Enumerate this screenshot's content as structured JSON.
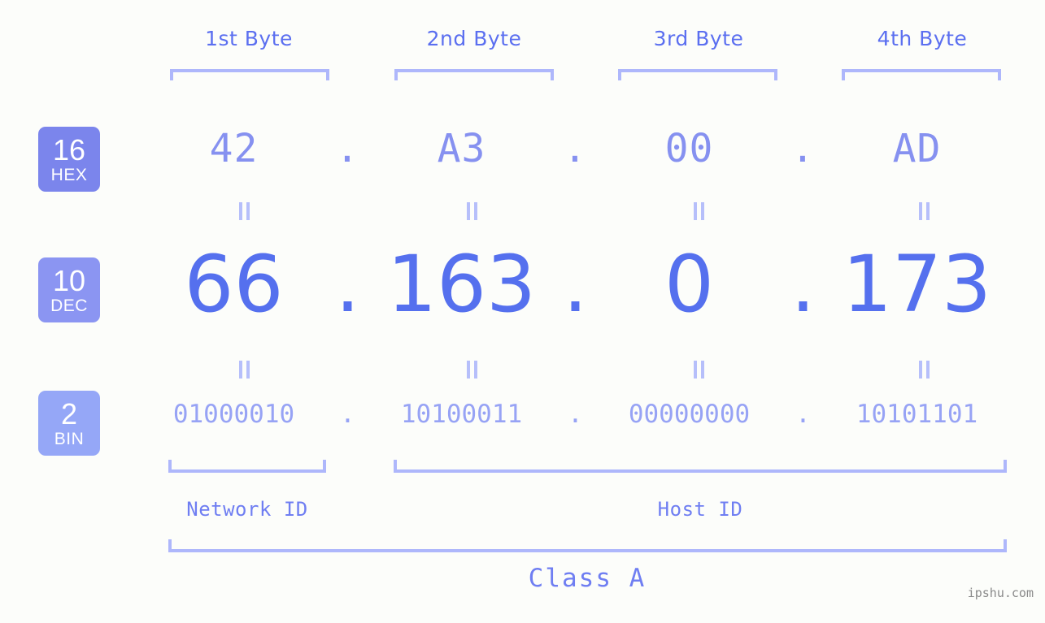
{
  "background_color": "#fcfdfa",
  "accent_colors": {
    "header_text": "#5b6ff0",
    "bracket": "#aeb7fb",
    "hex_text": "#8691f0",
    "dec_text": "#5570ee",
    "bin_text": "#97a3f5",
    "badge_hex": "#7b85ec",
    "badge_dec": "#8b95f2",
    "badge_bin": "#95a7f7",
    "label_text": "#6f7ef2",
    "watermark_text": "#8a8a8a"
  },
  "byte_headers": [
    {
      "label": "1st Byte"
    },
    {
      "label": "2nd Byte"
    },
    {
      "label": "3rd Byte"
    },
    {
      "label": "4th Byte"
    }
  ],
  "bases": [
    {
      "number": "16",
      "abbr": "HEX"
    },
    {
      "number": "10",
      "abbr": "DEC"
    },
    {
      "number": "2",
      "abbr": "BIN"
    }
  ],
  "separator": ".",
  "rows": {
    "hex": {
      "base_number": "16",
      "base_abbr": "HEX",
      "values": [
        "42",
        "A3",
        "00",
        "AD"
      ]
    },
    "dec": {
      "base_number": "10",
      "base_abbr": "DEC",
      "values": [
        "66",
        "163",
        "0",
        "173"
      ]
    },
    "bin": {
      "base_number": "2",
      "base_abbr": "BIN",
      "values": [
        "01000010",
        "10100011",
        "00000000",
        "10101101"
      ]
    }
  },
  "id_sections": [
    {
      "label": "Network ID"
    },
    {
      "label": "Host ID"
    }
  ],
  "class_label": "Class A",
  "watermark": "ipshu.com",
  "equality_symbol": "="
}
